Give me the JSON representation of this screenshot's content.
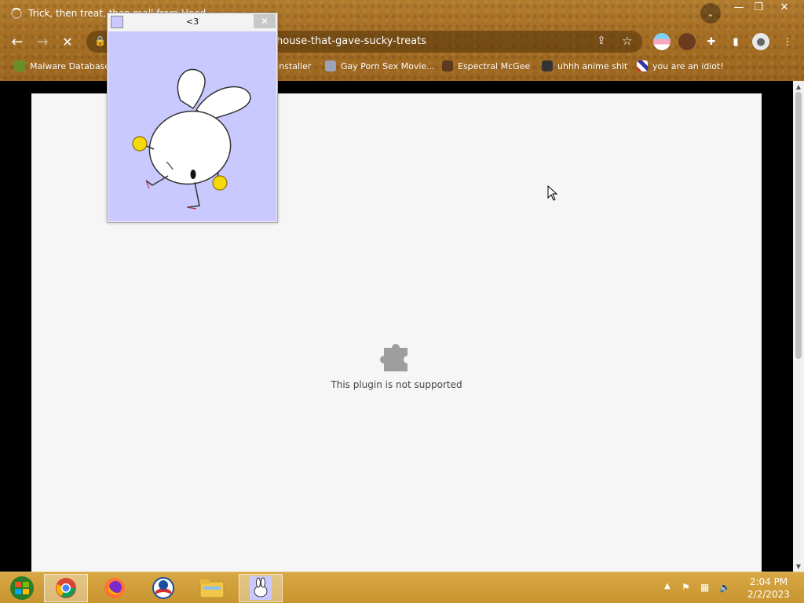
{
  "browser": {
    "tab_title": "Trick, then treat, then mall from Hood...",
    "url": "house-that-gave-sucky-treats",
    "bookmarks": [
      {
        "label": "Malware Database"
      },
      {
        "label": "Installer"
      },
      {
        "label": "Gay Porn Sex Movie..."
      },
      {
        "label": "Espectral McGee"
      },
      {
        "label": "uhhh anime shit"
      },
      {
        "label": "you are an idiot!"
      }
    ],
    "window_controls": {
      "minimize": "—",
      "maximize": "❐",
      "close": "✕"
    },
    "tab_menu_icon": "chevron-down-icon"
  },
  "page": {
    "plugin_message": "This plugin is not supported"
  },
  "popup": {
    "title": "<3",
    "close_label": "✕"
  },
  "taskbar": {
    "time": "2:04 PM",
    "date": "2/2/2023"
  }
}
